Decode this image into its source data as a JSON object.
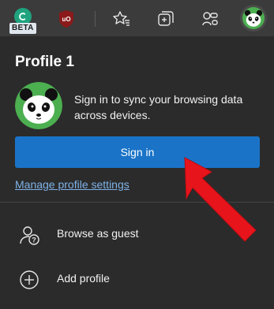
{
  "toolbar": {
    "extensions": [
      {
        "name": "copilot-beta",
        "badge": "BETA"
      },
      {
        "name": "ublock-origin",
        "label": "uO"
      }
    ],
    "icons": [
      "favorites-icon",
      "collections-icon",
      "share-icon",
      "profile-avatar"
    ]
  },
  "panel": {
    "title": "Profile 1",
    "signin_message": "Sign in to sync your browsing data across devices.",
    "signin_button": "Sign in",
    "manage_link": "Manage profile settings",
    "menu": [
      {
        "label": "Browse as guest",
        "icon": "guest-icon"
      },
      {
        "label": "Add profile",
        "icon": "add-circle-icon"
      }
    ]
  },
  "colors": {
    "toolbar_bg": "#3b3b3b",
    "panel_bg": "#2b2b2b",
    "accent_button": "#1a73c7",
    "link": "#7fb2e8",
    "annotation_arrow": "#e8141c"
  }
}
